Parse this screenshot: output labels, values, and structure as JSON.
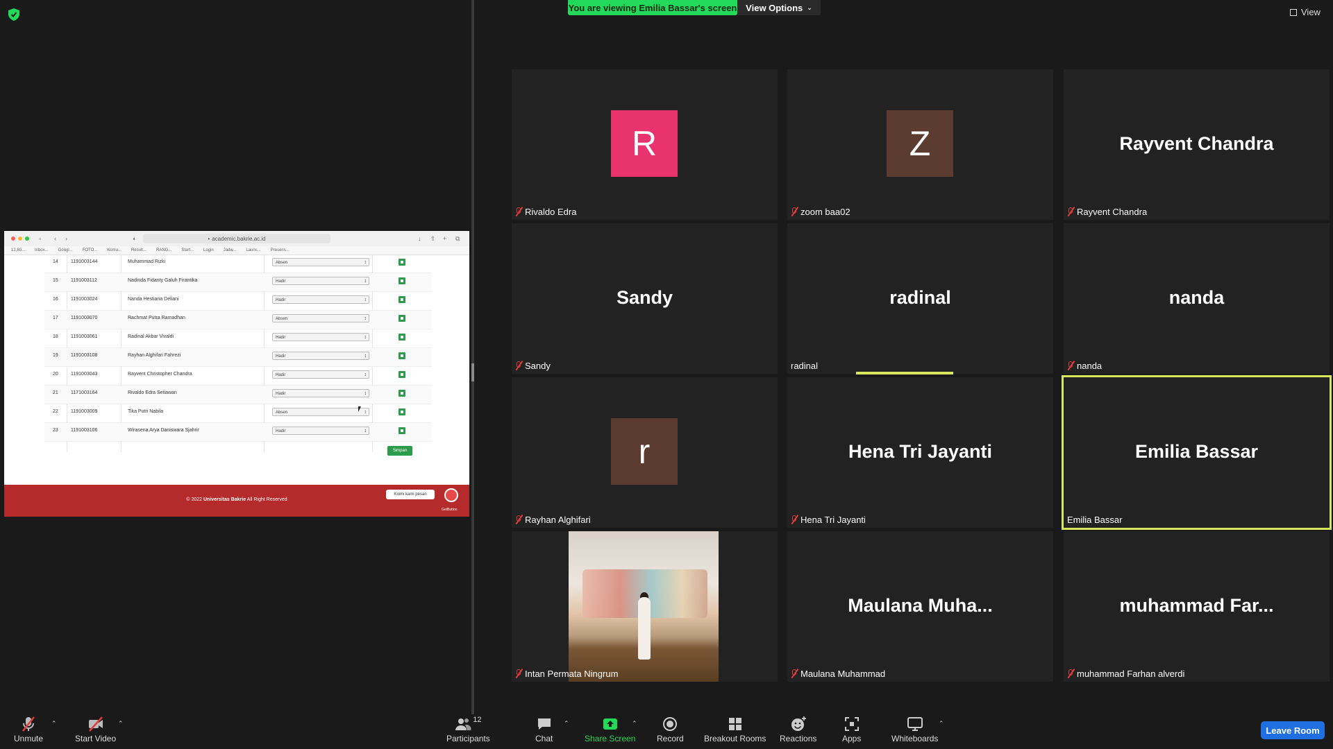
{
  "top": {
    "viewing_banner": "You are viewing Emilia Bassar's screen",
    "view_options": "View Options",
    "view": "View"
  },
  "shared_screen": {
    "url": "academic.bakrie.ac.id",
    "bookmarks": [
      "12,80...",
      "Inbox...",
      "Googl...",
      "FOTO...",
      "Komu...",
      "Result...",
      "RANG...",
      "Start...",
      "Login",
      "Jadw...",
      "Launc...",
      "Presens..."
    ],
    "rows": [
      {
        "no": "14",
        "nim": "1191003144",
        "name": "Muhammad Rizki",
        "status": "Absen"
      },
      {
        "no": "15",
        "nim": "1191003112",
        "name": "Nadinda Fidanty Galuh Firantika",
        "status": "Hadir"
      },
      {
        "no": "16",
        "nim": "1191003024",
        "name": "Nanda Hestiana Deliani",
        "status": "Hadir"
      },
      {
        "no": "17",
        "nim": "1191003070",
        "name": "Rachmat Putra Ramadhan",
        "status": "Absen"
      },
      {
        "no": "18",
        "nim": "1191003061",
        "name": "Radinal Akbar Vivaldi",
        "status": "Hadir"
      },
      {
        "no": "19",
        "nim": "1191003108",
        "name": "Rayhan Alghifari Fahrezi",
        "status": "Hadir"
      },
      {
        "no": "20",
        "nim": "1191003043",
        "name": "Rayvent Christopher Chandra",
        "status": "Hadir"
      },
      {
        "no": "21",
        "nim": "1171003164",
        "name": "Rivaldo Edra Setiawan",
        "status": "Hadir"
      },
      {
        "no": "22",
        "nim": "1191003009",
        "name": "Tika Putri Nabila",
        "status": "Absen"
      },
      {
        "no": "23",
        "nim": "1191003106",
        "name": "Wirasena Arya Daniswara Sjahrir",
        "status": "Hadir"
      }
    ],
    "save_label": "Simpan",
    "footer_prefix": "© 2022",
    "footer_brand": "Universitas Bakrie",
    "footer_suffix": "All Right Reserved",
    "chat_label": "Kirimi kami pesan",
    "getbutton": "GetButton"
  },
  "participants_tiles": [
    {
      "name": "Rivaldo Edra",
      "avatar": "R",
      "avatar_color": "#e8336f",
      "muted": true
    },
    {
      "name": "zoom baa02",
      "avatar": "Z",
      "avatar_color": "#5c3b31",
      "muted": true
    },
    {
      "name": "Rayvent Chandra",
      "display": "Rayvent Chandra",
      "muted": true
    },
    {
      "name": "Sandy",
      "display": "Sandy",
      "muted": true
    },
    {
      "name": "radinal",
      "display": "radinal",
      "muted": false
    },
    {
      "name": "nanda",
      "display": "nanda",
      "muted": true
    },
    {
      "name": "Rayhan Alghifari",
      "avatar": "r",
      "avatar_color": "#5c3b31",
      "muted": true
    },
    {
      "name": "Hena Tri Jayanti",
      "display": "Hena Tri Jayanti",
      "muted": true
    },
    {
      "name": "Emilia Bassar",
      "display": "Emilia Bassar",
      "muted": false
    },
    {
      "name": "Intan Permata Ningrum",
      "photo": true,
      "muted": true
    },
    {
      "name": "Maulana Muhammad",
      "display": "Maulana  Muha...",
      "muted": true
    },
    {
      "name": "muhammad Farhan alverdi",
      "display": "muhammad  Far...",
      "muted": true
    }
  ],
  "toolbar": {
    "unmute": "Unmute",
    "start_video": "Start Video",
    "participants_count": "12",
    "participants": "Participants",
    "chat": "Chat",
    "share_screen": "Share Screen",
    "record": "Record",
    "breakout": "Breakout Rooms",
    "reactions": "Reactions",
    "apps": "Apps",
    "whiteboards": "Whiteboards",
    "leave": "Leave Room"
  },
  "colors": {
    "banner": "#23d959",
    "active_border": "#d7e65a",
    "leave": "#1f6fe0",
    "muted": "#e23b3b"
  }
}
